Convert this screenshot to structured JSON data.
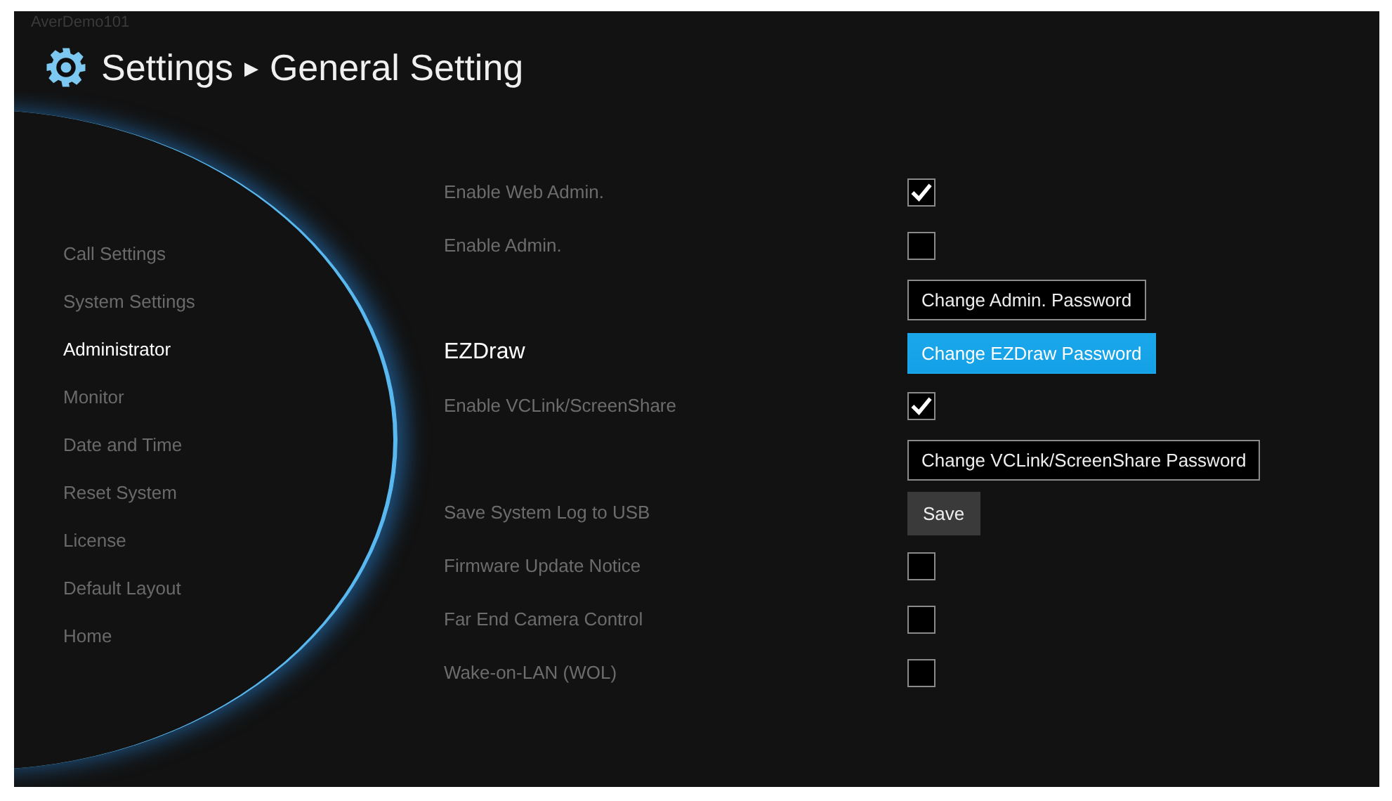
{
  "device_name": "AverDemo101",
  "header": {
    "section": "Settings",
    "separator": "▶",
    "title": "General Setting"
  },
  "sidebar": {
    "items": [
      {
        "label": "Call Settings",
        "selected": false
      },
      {
        "label": "System Settings",
        "selected": false
      },
      {
        "label": "Administrator",
        "selected": true
      },
      {
        "label": "Monitor",
        "selected": false
      },
      {
        "label": "Date and Time",
        "selected": false
      },
      {
        "label": "Reset System",
        "selected": false
      },
      {
        "label": "License",
        "selected": false
      },
      {
        "label": "Default Layout",
        "selected": false
      },
      {
        "label": "Home",
        "selected": false
      }
    ]
  },
  "rows": [
    {
      "kind": "checkbox",
      "label": "Enable Web Admin.",
      "checked": true
    },
    {
      "kind": "checkbox",
      "label": "Enable Admin.",
      "checked": false
    },
    {
      "kind": "button",
      "button": "Change Admin. Password",
      "focused": false
    },
    {
      "kind": "heading",
      "label": "EZDraw",
      "button": "Change EZDraw Password",
      "focused": true
    },
    {
      "kind": "checkbox",
      "label": "Enable VCLink/ScreenShare",
      "checked": true
    },
    {
      "kind": "button",
      "button": "Change VCLink/ScreenShare Password",
      "focused": false
    },
    {
      "kind": "action",
      "label": "Save System Log to USB",
      "button": "Save"
    },
    {
      "kind": "checkbox",
      "label": "Firmware Update Notice",
      "checked": false
    },
    {
      "kind": "checkbox",
      "label": "Far End Camera Control",
      "checked": false
    },
    {
      "kind": "checkbox",
      "label": "Wake-on-LAN (WOL)",
      "checked": false
    }
  ]
}
